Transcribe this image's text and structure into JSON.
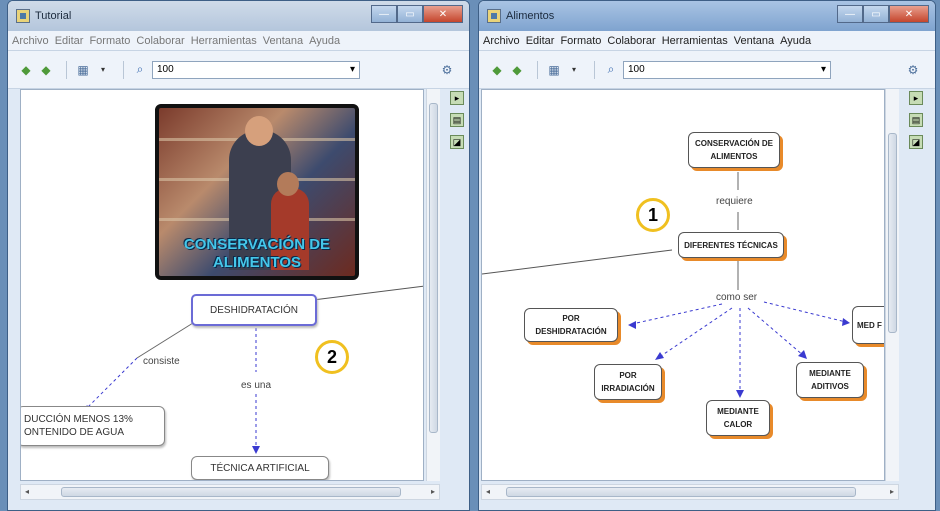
{
  "left_window": {
    "title": "Tutorial",
    "menu": [
      "Archivo",
      "Editar",
      "Formato",
      "Colaborar",
      "Herramientas",
      "Ventana",
      "Ayuda"
    ],
    "zoom": "100",
    "image_caption": "CONSERVACIÓN DE ALIMENTOS",
    "nodes": {
      "deshidratacion": "DESHIDRATACIÓN",
      "reduccion": "DUCCIÓN MENOS 13% ONTENIDO DE AGUA",
      "tecnica": "TÉCNICA ARTIFICIAL"
    },
    "links": {
      "consiste": "consiste",
      "es_una": "es una"
    },
    "badge": "2"
  },
  "right_window": {
    "title": "Alimentos",
    "menu": [
      "Archivo",
      "Editar",
      "Formato",
      "Colaborar",
      "Herramientas",
      "Ventana",
      "Ayuda"
    ],
    "zoom": "100",
    "nodes": {
      "conservacion": "CONSERVACIÓN DE ALIMENTOS",
      "diferentes": "DIFERENTES TÉCNICAS",
      "deshidratacion": "POR DESHIDRATACIÓN",
      "irradiacion": "POR IRRADIACIÓN",
      "calor": "MEDIANTE CALOR",
      "aditivos": "MEDIANTE ADITIVOS",
      "partial": "MED F"
    },
    "links": {
      "requiere": "requiere",
      "como_ser": "como ser"
    },
    "badge": "1"
  },
  "colors": {
    "accent_shadow": "#e88a2a",
    "badge_ring": "#f0c020",
    "dashed_link": "#3a3ad0"
  }
}
